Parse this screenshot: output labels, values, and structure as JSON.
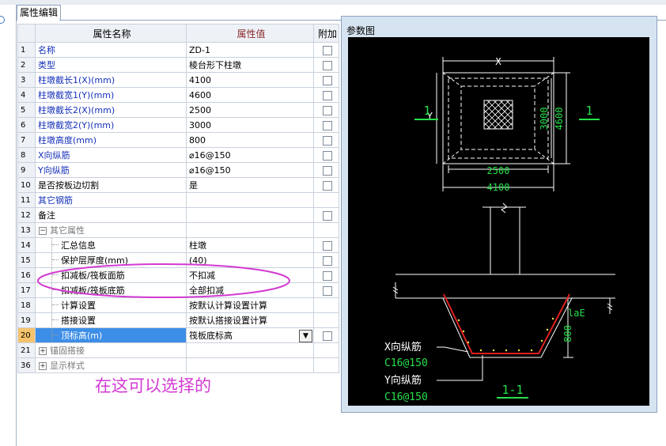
{
  "tab": {
    "label": "属性编辑"
  },
  "table": {
    "headers": [
      "",
      "属性名称",
      "属性值",
      "附加"
    ],
    "rows": [
      {
        "num": "1",
        "name": "名称",
        "value": "ZD-1",
        "kind": "prop",
        "check": true
      },
      {
        "num": "2",
        "name": "类型",
        "value": "棱台形下柱墩",
        "kind": "prop",
        "check": true
      },
      {
        "num": "3",
        "name": "柱墩截长1(X)(mm)",
        "value": "4100",
        "kind": "prop",
        "check": true
      },
      {
        "num": "4",
        "name": "柱墩截宽1(Y)(mm)",
        "value": "4600",
        "kind": "prop",
        "check": true
      },
      {
        "num": "5",
        "name": "柱墩截长2(X)(mm)",
        "value": "2500",
        "kind": "prop",
        "check": true
      },
      {
        "num": "6",
        "name": "柱墩截宽2(Y)(mm)",
        "value": "3000",
        "kind": "prop",
        "check": true
      },
      {
        "num": "7",
        "name": "柱墩高度(mm)",
        "value": "800",
        "kind": "prop",
        "check": true
      },
      {
        "num": "8",
        "name": "X向纵筋",
        "value": "⌀16@150",
        "kind": "prop",
        "check": true
      },
      {
        "num": "9",
        "name": "Y向纵筋",
        "value": "⌀16@150",
        "kind": "prop",
        "check": true
      },
      {
        "num": "10",
        "name": "是否按板边切割",
        "value": "是",
        "kind": "plain",
        "check": true
      },
      {
        "num": "11",
        "name": "其它钢筋",
        "value": "",
        "kind": "prop",
        "check": false
      },
      {
        "num": "12",
        "name": "备注",
        "value": "",
        "kind": "plain",
        "check": true
      },
      {
        "num": "13",
        "name": "其它属性",
        "value": "",
        "kind": "group",
        "expander": "−",
        "check": false
      },
      {
        "num": "14",
        "name": "汇总信息",
        "value": "柱墩",
        "kind": "child",
        "check": true
      },
      {
        "num": "15",
        "name": "保护层厚度(mm)",
        "value": "(40)",
        "kind": "child",
        "check": true
      },
      {
        "num": "16",
        "name": "扣减板/筏板面筋",
        "value": "不扣减",
        "kind": "child",
        "check": true
      },
      {
        "num": "17",
        "name": "扣减板/筏板底筋",
        "value": "全部扣减",
        "kind": "child",
        "check": true
      },
      {
        "num": "18",
        "name": "计算设置",
        "value": "按默认计算设置计算",
        "kind": "child",
        "check": false
      },
      {
        "num": "19",
        "name": "搭接设置",
        "value": "按默认搭接设置计算",
        "kind": "child",
        "check": false
      },
      {
        "num": "20",
        "name": "顶标高(m)",
        "value": "筏板底标高",
        "kind": "child",
        "selected": true,
        "dropdown": true,
        "check": true
      },
      {
        "num": "21",
        "name": "锚固搭接",
        "value": "",
        "kind": "group",
        "expander": "+",
        "check": false
      },
      {
        "num": "36",
        "name": "显示样式",
        "value": "",
        "kind": "group",
        "expander": "+",
        "check": false
      }
    ]
  },
  "annotation": "在这可以选择的",
  "diagram": {
    "window_title": "参数图",
    "labels": {
      "x": "X",
      "y": "Y",
      "len2": "2500",
      "len1": "4100",
      "wid2": "3000",
      "wid1": "4600",
      "sec_left": "1",
      "sec_right": "1",
      "lae": "laE",
      "h": "800",
      "x_rebar": "X向纵筋",
      "x_rebar_spec": "C16@150",
      "y_rebar": "Y向纵筋",
      "y_rebar_spec": "C16@150",
      "section": "1-1"
    }
  },
  "colors": {
    "header_value_bg": "#f7d79a",
    "selected": "#3d8ee6",
    "link_text": "#1530b8",
    "annotation": "#d23ad2",
    "diagram_green": "#26e04a",
    "rebar_red": "#e02020"
  }
}
